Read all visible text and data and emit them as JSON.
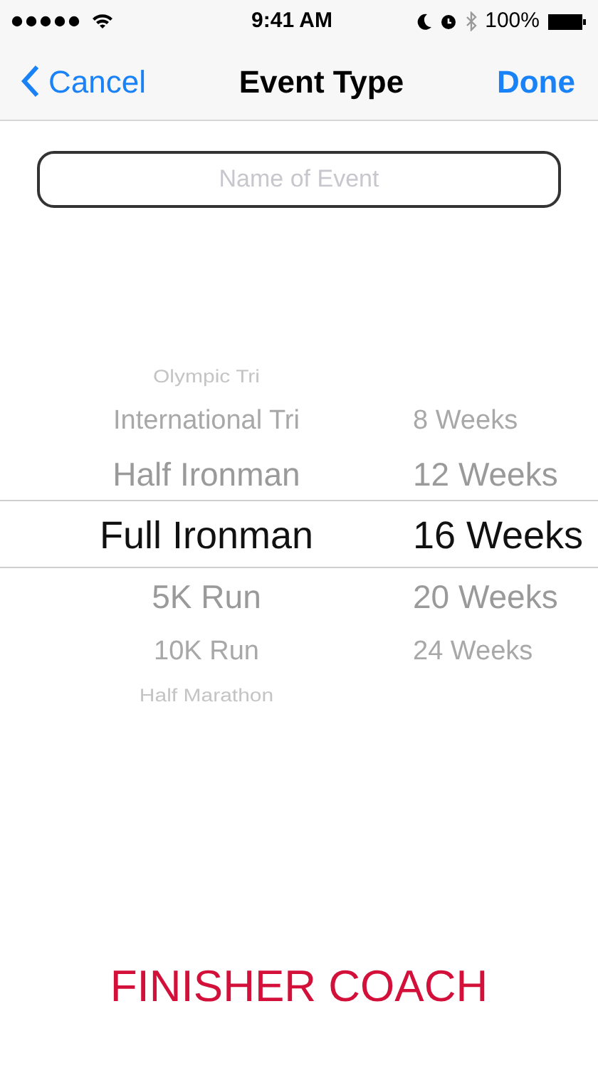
{
  "status_bar": {
    "time": "9:41 AM",
    "battery": "100%"
  },
  "nav_bar": {
    "back": "Cancel",
    "title": "Event Type",
    "action": "Done"
  },
  "name_field": {
    "placeholder": "Name of Event"
  },
  "picker": {
    "columns": [
      {
        "items": [
          {
            "label": "Olympic Tri",
            "selected": false
          },
          {
            "label": "International Tri",
            "selected": false
          },
          {
            "label": "Half Ironman",
            "selected": false
          },
          {
            "label": "Full Ironman",
            "selected": true
          },
          {
            "label": "5K Run",
            "selected": false
          },
          {
            "label": "10K Run",
            "selected": false
          },
          {
            "label": "Half Marathon",
            "selected": false
          }
        ]
      },
      {
        "items": [
          {
            "label": "8 Weeks",
            "selected": false
          },
          {
            "label": "12 Weeks",
            "selected": false
          },
          {
            "label": "16 Weeks",
            "selected": true
          },
          {
            "label": "20 Weeks",
            "selected": false
          },
          {
            "label": "24 Weeks",
            "selected": false
          }
        ]
      }
    ]
  },
  "footer": {
    "brand": "FINISHER COACH"
  }
}
